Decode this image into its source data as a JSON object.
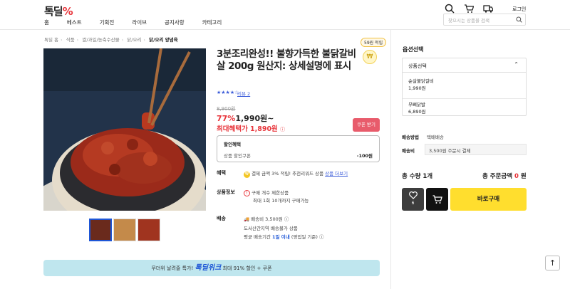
{
  "header": {
    "logo_main": "톡딜",
    "logo_pct": "%",
    "nav": [
      "홈",
      "베스트",
      "기획전",
      "라이브",
      "공지사항",
      "카테고리"
    ],
    "login": "로그인",
    "search_placeholder": "찾으시는 상품을 검색"
  },
  "breadcrumb": [
    "톡딜 홈",
    "식품",
    "쌀/과일/농축수산물",
    "닭/오리",
    "닭/오리 양념육"
  ],
  "gallery": {
    "thumbs": [
      "thumb-1",
      "thumb-2",
      "thumb-3"
    ]
  },
  "product": {
    "title": "3분조리완성!! 불향가득한 불닭갈비살 200g 원산지: 상세설명에 표시",
    "points_badge": "59원 적립",
    "stars": "★★★★☆",
    "review_label": "리뷰 2",
    "original_price": "8,900원",
    "discount_pct": "77%",
    "price": "1,990원~",
    "max_benefit": "최대혜택가 1,890원",
    "coupon_button": "쿠폰 받기",
    "discount": {
      "title": "할인혜택",
      "label": "상품 할인쿠폰",
      "value": "-100원"
    },
    "benefit": {
      "label": "혜택",
      "text": "결제 금액 3% 적립! 추천리워드 상품",
      "link": "상품 더보기"
    },
    "info": {
      "label": "상품정보",
      "line1": "구매 개수 제한상품",
      "line2": "최대 1회 10개까지 구매가능"
    },
    "delivery": {
      "label": "배송",
      "fee": "배송비 3,500원",
      "line2": "도서산간지역 배송불가 상품",
      "line3_pre": "평균 배송기간",
      "line3_em": "1일 이내",
      "line3_post": "(영업일 기준)"
    }
  },
  "banner": {
    "pre": "무더위 날려줄 특가!",
    "brand": "톡딜위크",
    "post": "최대 91% 할인 + 쿠폰"
  },
  "options": {
    "title": "옵션선택",
    "select_label": "상품선택",
    "items": [
      {
        "name": "순살불닭갈비",
        "price": "1,990원"
      },
      {
        "name": "무뼈닭발",
        "price": "6,890원"
      }
    ],
    "ship_method_label": "배송방법",
    "ship_method": "택배배송",
    "ship_fee_label": "배송비",
    "ship_fee": "3,500원 주문시 결제",
    "total_qty": "총 수량 1개",
    "total_price_pre": "총 주문금액",
    "total_price_val": "0",
    "total_price_unit": "원",
    "wish_count": "6",
    "buy_button": "바로구매"
  },
  "colors": {
    "accent_red": "#e8363c",
    "buy_yellow": "#ffde2e",
    "link_blue": "#3a5bd9"
  }
}
